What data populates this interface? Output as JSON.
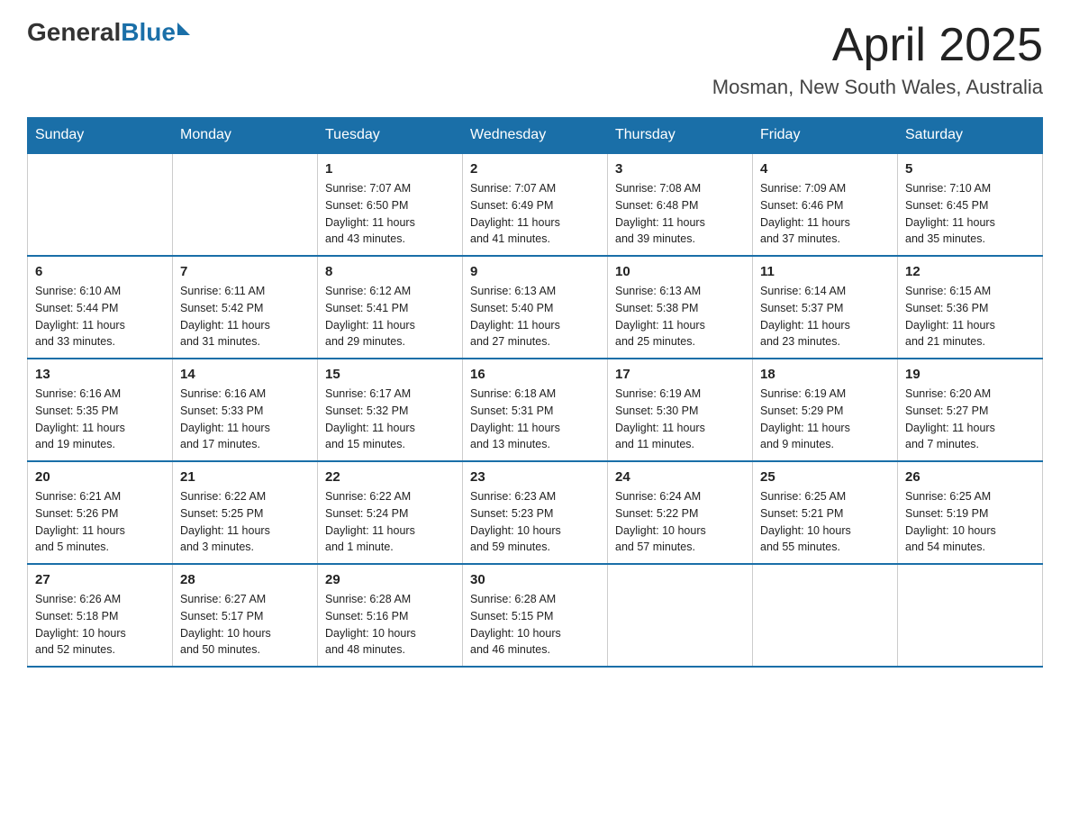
{
  "header": {
    "logo": {
      "general": "General",
      "blue": "Blue"
    },
    "title": "April 2025",
    "location": "Mosman, New South Wales, Australia"
  },
  "days_of_week": [
    "Sunday",
    "Monday",
    "Tuesday",
    "Wednesday",
    "Thursday",
    "Friday",
    "Saturday"
  ],
  "weeks": [
    [
      {
        "day": "",
        "info": ""
      },
      {
        "day": "",
        "info": ""
      },
      {
        "day": "1",
        "info": "Sunrise: 7:07 AM\nSunset: 6:50 PM\nDaylight: 11 hours\nand 43 minutes."
      },
      {
        "day": "2",
        "info": "Sunrise: 7:07 AM\nSunset: 6:49 PM\nDaylight: 11 hours\nand 41 minutes."
      },
      {
        "day": "3",
        "info": "Sunrise: 7:08 AM\nSunset: 6:48 PM\nDaylight: 11 hours\nand 39 minutes."
      },
      {
        "day": "4",
        "info": "Sunrise: 7:09 AM\nSunset: 6:46 PM\nDaylight: 11 hours\nand 37 minutes."
      },
      {
        "day": "5",
        "info": "Sunrise: 7:10 AM\nSunset: 6:45 PM\nDaylight: 11 hours\nand 35 minutes."
      }
    ],
    [
      {
        "day": "6",
        "info": "Sunrise: 6:10 AM\nSunset: 5:44 PM\nDaylight: 11 hours\nand 33 minutes."
      },
      {
        "day": "7",
        "info": "Sunrise: 6:11 AM\nSunset: 5:42 PM\nDaylight: 11 hours\nand 31 minutes."
      },
      {
        "day": "8",
        "info": "Sunrise: 6:12 AM\nSunset: 5:41 PM\nDaylight: 11 hours\nand 29 minutes."
      },
      {
        "day": "9",
        "info": "Sunrise: 6:13 AM\nSunset: 5:40 PM\nDaylight: 11 hours\nand 27 minutes."
      },
      {
        "day": "10",
        "info": "Sunrise: 6:13 AM\nSunset: 5:38 PM\nDaylight: 11 hours\nand 25 minutes."
      },
      {
        "day": "11",
        "info": "Sunrise: 6:14 AM\nSunset: 5:37 PM\nDaylight: 11 hours\nand 23 minutes."
      },
      {
        "day": "12",
        "info": "Sunrise: 6:15 AM\nSunset: 5:36 PM\nDaylight: 11 hours\nand 21 minutes."
      }
    ],
    [
      {
        "day": "13",
        "info": "Sunrise: 6:16 AM\nSunset: 5:35 PM\nDaylight: 11 hours\nand 19 minutes."
      },
      {
        "day": "14",
        "info": "Sunrise: 6:16 AM\nSunset: 5:33 PM\nDaylight: 11 hours\nand 17 minutes."
      },
      {
        "day": "15",
        "info": "Sunrise: 6:17 AM\nSunset: 5:32 PM\nDaylight: 11 hours\nand 15 minutes."
      },
      {
        "day": "16",
        "info": "Sunrise: 6:18 AM\nSunset: 5:31 PM\nDaylight: 11 hours\nand 13 minutes."
      },
      {
        "day": "17",
        "info": "Sunrise: 6:19 AM\nSunset: 5:30 PM\nDaylight: 11 hours\nand 11 minutes."
      },
      {
        "day": "18",
        "info": "Sunrise: 6:19 AM\nSunset: 5:29 PM\nDaylight: 11 hours\nand 9 minutes."
      },
      {
        "day": "19",
        "info": "Sunrise: 6:20 AM\nSunset: 5:27 PM\nDaylight: 11 hours\nand 7 minutes."
      }
    ],
    [
      {
        "day": "20",
        "info": "Sunrise: 6:21 AM\nSunset: 5:26 PM\nDaylight: 11 hours\nand 5 minutes."
      },
      {
        "day": "21",
        "info": "Sunrise: 6:22 AM\nSunset: 5:25 PM\nDaylight: 11 hours\nand 3 minutes."
      },
      {
        "day": "22",
        "info": "Sunrise: 6:22 AM\nSunset: 5:24 PM\nDaylight: 11 hours\nand 1 minute."
      },
      {
        "day": "23",
        "info": "Sunrise: 6:23 AM\nSunset: 5:23 PM\nDaylight: 10 hours\nand 59 minutes."
      },
      {
        "day": "24",
        "info": "Sunrise: 6:24 AM\nSunset: 5:22 PM\nDaylight: 10 hours\nand 57 minutes."
      },
      {
        "day": "25",
        "info": "Sunrise: 6:25 AM\nSunset: 5:21 PM\nDaylight: 10 hours\nand 55 minutes."
      },
      {
        "day": "26",
        "info": "Sunrise: 6:25 AM\nSunset: 5:19 PM\nDaylight: 10 hours\nand 54 minutes."
      }
    ],
    [
      {
        "day": "27",
        "info": "Sunrise: 6:26 AM\nSunset: 5:18 PM\nDaylight: 10 hours\nand 52 minutes."
      },
      {
        "day": "28",
        "info": "Sunrise: 6:27 AM\nSunset: 5:17 PM\nDaylight: 10 hours\nand 50 minutes."
      },
      {
        "day": "29",
        "info": "Sunrise: 6:28 AM\nSunset: 5:16 PM\nDaylight: 10 hours\nand 48 minutes."
      },
      {
        "day": "30",
        "info": "Sunrise: 6:28 AM\nSunset: 5:15 PM\nDaylight: 10 hours\nand 46 minutes."
      },
      {
        "day": "",
        "info": ""
      },
      {
        "day": "",
        "info": ""
      },
      {
        "day": "",
        "info": ""
      }
    ]
  ]
}
